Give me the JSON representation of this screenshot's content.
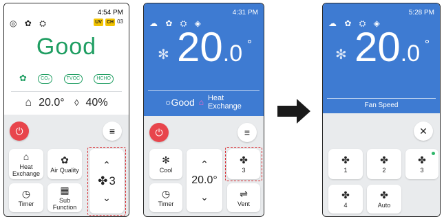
{
  "screen1": {
    "time": "4:54 PM",
    "status_icons": "◎ ✿ ⛭",
    "badges": [
      "UV",
      "CH"
    ],
    "badge_num": "03",
    "air_quality": "Good",
    "sensors": [
      "✿",
      "CO₂",
      "TVOC",
      "HCHO"
    ],
    "temperature": "20.0°",
    "humidity": "40%",
    "buttons": {
      "heat_exchange": "Heat Exchange",
      "air_quality": "Air Quality",
      "timer": "Timer",
      "sub_function": "Sub Function",
      "fan_speed": "3"
    }
  },
  "screen2": {
    "time": "4:31 PM",
    "status_icons": "☁ ✿ ⛭ ◈",
    "temp_int": "20",
    "temp_dec": ".0",
    "degree": "°",
    "air_quality": "Good",
    "heat_exchange": "Heat Exchange",
    "buttons": {
      "cool": "Cool",
      "fan": "3",
      "set_temp": "20.0°",
      "timer": "Timer",
      "vent": "Vent"
    }
  },
  "screen3": {
    "time": "5:28 PM",
    "status_icons": "☁ ✿ ⛭ ◈",
    "temp_int": "20",
    "temp_dec": ".0",
    "degree": "°",
    "label": "Fan Speed",
    "options": [
      "1",
      "2",
      "3",
      "4",
      "Auto"
    ]
  },
  "icons": {
    "fan": "✤",
    "power": "⏻",
    "menu": "≡",
    "close": "✕",
    "snow": "✻",
    "timer": "◷",
    "up": "⌃",
    "down": "⌄",
    "vent": "⇌",
    "heat": "⌂",
    "grid": "▦",
    "home": "⌂",
    "drop": "💧"
  },
  "colors": {
    "good_green": "#1f9e62",
    "blue_bg": "#3e7bd2",
    "power_red": "#e8454c",
    "highlight_red": "#d8252b"
  }
}
